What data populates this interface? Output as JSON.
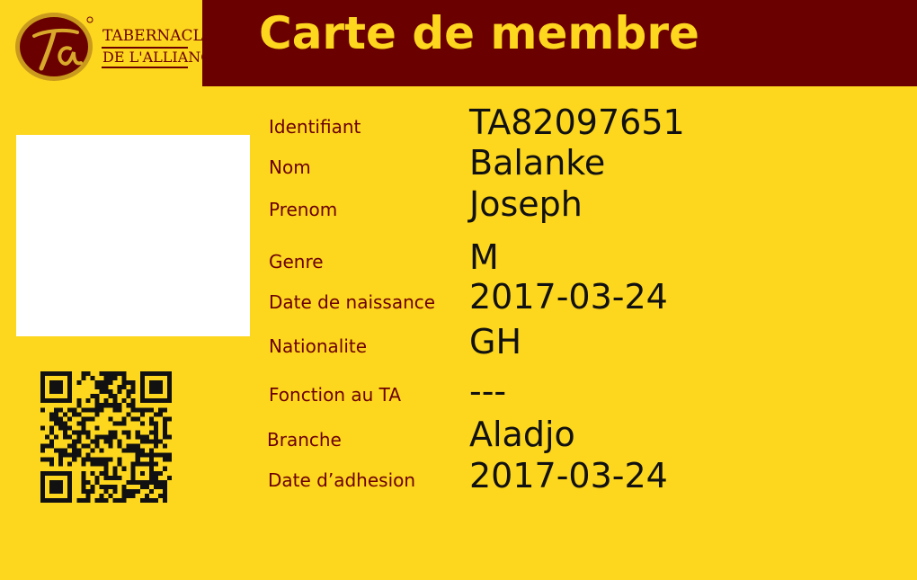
{
  "header": {
    "title": "Carte de membre"
  },
  "logo": {
    "monogram": "ta",
    "line1": "TABERNACLE",
    "line2": "DE L'ALLIANCE"
  },
  "photo": {
    "present": true
  },
  "qr": {
    "icon": "qr-code-icon"
  },
  "fields": [
    {
      "label": "Identifiant",
      "value": "TA82097651"
    },
    {
      "label": "Nom",
      "value": "Balanke"
    },
    {
      "label": "Prenom",
      "value": "Joseph"
    },
    {
      "label": "Genre",
      "value": "M"
    },
    {
      "label": "Date de naissance",
      "value": "2017-03-24"
    },
    {
      "label": "Nationalite",
      "value": "GH"
    },
    {
      "label": "Fonction au TA",
      "value": "---"
    },
    {
      "label": "Branche",
      "value": "Aladjo"
    },
    {
      "label": "Date d’adhesion",
      "value": "2017-03-24"
    }
  ],
  "colors": {
    "background": "#fdd61e",
    "brand": "#6b0000",
    "value_text": "#111111"
  }
}
